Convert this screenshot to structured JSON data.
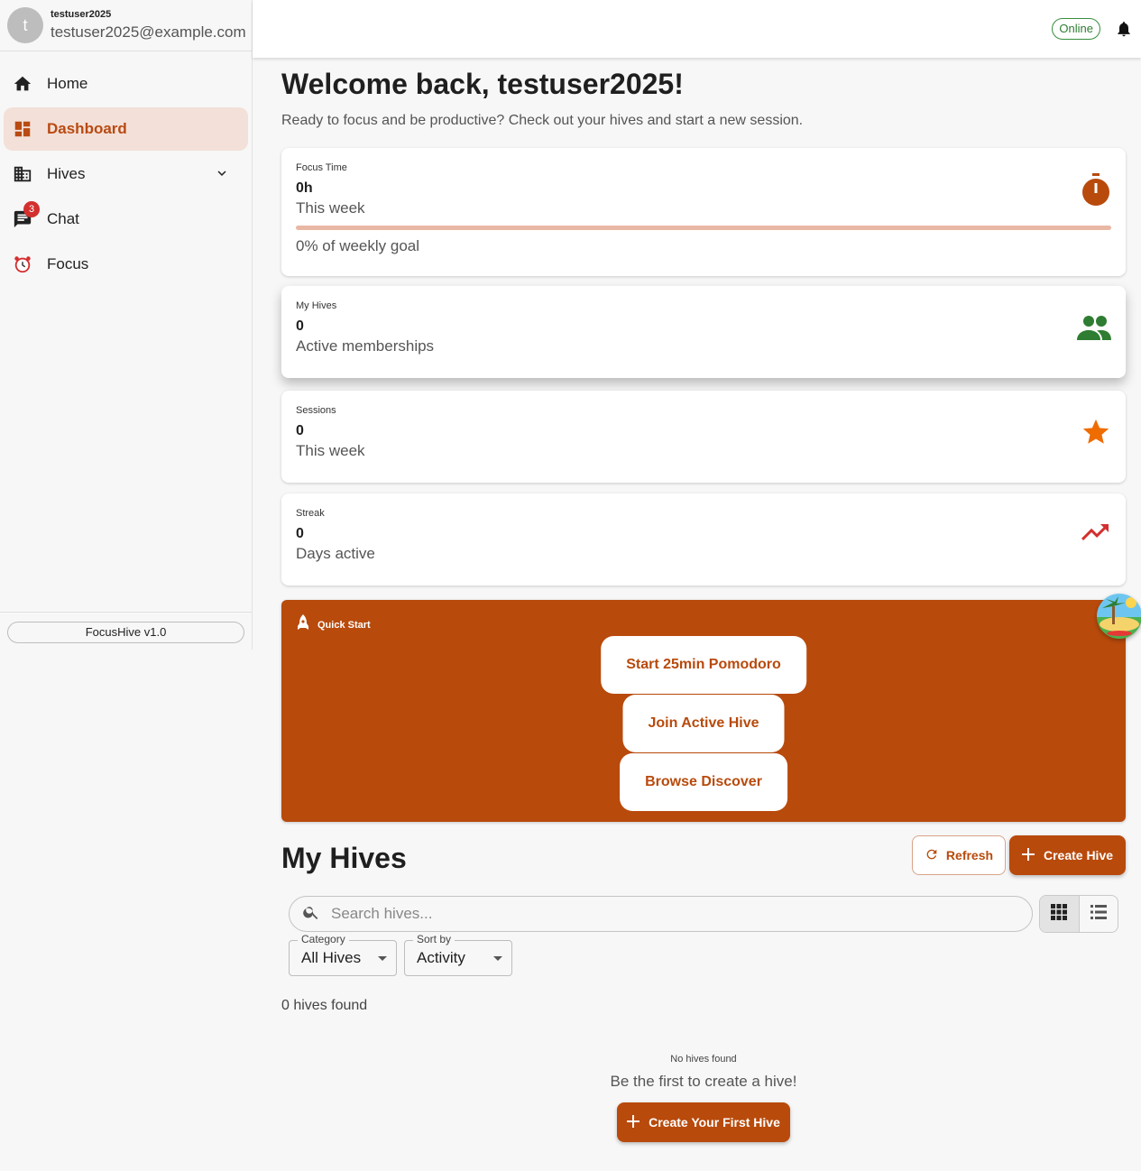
{
  "user": {
    "initial": "t",
    "name": "testuser2025",
    "email": "testuser2025@example.com"
  },
  "sidebar": {
    "items": [
      {
        "label": "Home",
        "icon": "home-icon"
      },
      {
        "label": "Dashboard",
        "icon": "dashboard-icon",
        "active": true
      },
      {
        "label": "Hives",
        "icon": "building-icon"
      },
      {
        "label": "Chat",
        "icon": "chat-icon",
        "badge": "3"
      },
      {
        "label": "Focus",
        "icon": "alarm-clock-icon"
      }
    ],
    "version": "FocusHive v1.0"
  },
  "topbar": {
    "status": "Online",
    "status_color": "#2e7d32"
  },
  "welcome": {
    "title": "Welcome back, testuser2025!",
    "subtitle": "Ready to focus and be productive? Check out your hives and start a new session."
  },
  "stats": [
    {
      "label": "Focus Time",
      "value": "0h",
      "sub": "This week",
      "goal": "0% of weekly goal",
      "progress": 0,
      "icon": "timer-icon",
      "icon_color": "#b84a0c"
    },
    {
      "label": "My Hives",
      "value": "0",
      "sub": "Active memberships",
      "icon": "group-icon",
      "icon_color": "#2e7d32"
    },
    {
      "label": "Sessions",
      "value": "0",
      "sub": "This week",
      "icon": "star-icon",
      "icon_color": "#ef6c00"
    },
    {
      "label": "Streak",
      "value": "0",
      "sub": "Days active",
      "icon": "trending-up-icon",
      "icon_color": "#d32f2f"
    }
  ],
  "quick_start": {
    "title": "Quick Start",
    "buttons": [
      "Start 25min Pomodoro",
      "Join Active Hive",
      "Browse Discover"
    ],
    "bg_color": "#b84a0c"
  },
  "my_hives": {
    "title": "My Hives",
    "refresh_label": "Refresh",
    "create_label": "Create Hive",
    "search_placeholder": "Search hives...",
    "category_label": "Category",
    "category_value": "All Hives",
    "sort_label": "Sort by",
    "sort_value": "Activity",
    "count_text": "0 hives found",
    "empty_title": "No hives found",
    "empty_sub": "Be the first to create a hive!",
    "first_label": "Create Your First Hive"
  }
}
